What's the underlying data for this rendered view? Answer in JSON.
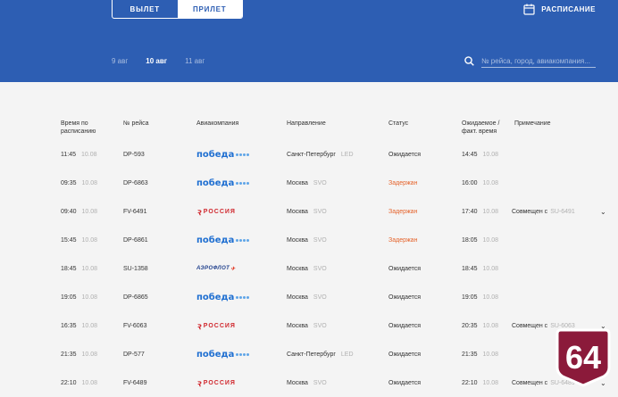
{
  "tabs": {
    "departure": "ВЫЛЕТ",
    "arrival": "ПРИЛЕТ"
  },
  "schedule_label": "РАСПИСАНИЕ",
  "dates": [
    "9 авг",
    "10 авг",
    "11 авг"
  ],
  "search": {
    "placeholder": "№ рейса, город, авиакомпания..."
  },
  "headers": {
    "scheduled": "Время по расписанию",
    "flight": "№ рейса",
    "airline": "Авиакомпания",
    "direction": "Направление",
    "status": "Статус",
    "expected": "Ожидаемое / факт. время",
    "note": "Примечание"
  },
  "logos": {
    "pobeda": "победа",
    "russia": "РОССИЯ",
    "aeroflot": "АЭРОФЛОТ"
  },
  "rows": [
    {
      "time": "11:45",
      "date": "10.08",
      "flight": "DP-593",
      "airline": "pobeda",
      "city": "Санкт-Петербург",
      "code": "LED",
      "status": "Ожидается",
      "exp_time": "14:45",
      "exp_date": "10.08",
      "note_prefix": "",
      "note_code": ""
    },
    {
      "time": "09:35",
      "date": "10.08",
      "flight": "DP-6863",
      "airline": "pobeda",
      "city": "Москва",
      "code": "SVO",
      "status": "Задержан",
      "exp_time": "16:00",
      "exp_date": "10.08",
      "note_prefix": "",
      "note_code": ""
    },
    {
      "time": "09:40",
      "date": "10.08",
      "flight": "FV-6491",
      "airline": "russia",
      "city": "Москва",
      "code": "SVO",
      "status": "Задержан",
      "exp_time": "17:40",
      "exp_date": "10.08",
      "note_prefix": "Совмещен с",
      "note_code": "SU-6491"
    },
    {
      "time": "15:45",
      "date": "10.08",
      "flight": "DP-6861",
      "airline": "pobeda",
      "city": "Москва",
      "code": "SVO",
      "status": "Задержан",
      "exp_time": "18:05",
      "exp_date": "10.08",
      "note_prefix": "",
      "note_code": ""
    },
    {
      "time": "18:45",
      "date": "10.08",
      "flight": "SU-1358",
      "airline": "aeroflot",
      "city": "Москва",
      "code": "SVO",
      "status": "Ожидается",
      "exp_time": "18:45",
      "exp_date": "10.08",
      "note_prefix": "",
      "note_code": ""
    },
    {
      "time": "19:05",
      "date": "10.08",
      "flight": "DP-6865",
      "airline": "pobeda",
      "city": "Москва",
      "code": "SVO",
      "status": "Ожидается",
      "exp_time": "19:05",
      "exp_date": "10.08",
      "note_prefix": "",
      "note_code": ""
    },
    {
      "time": "16:35",
      "date": "10.08",
      "flight": "FV-6063",
      "airline": "russia",
      "city": "Москва",
      "code": "SVO",
      "status": "Ожидается",
      "exp_time": "20:35",
      "exp_date": "10.08",
      "note_prefix": "Совмещен с",
      "note_code": "SU-6063"
    },
    {
      "time": "21:35",
      "date": "10.08",
      "flight": "DP-577",
      "airline": "pobeda",
      "city": "Санкт-Петербург",
      "code": "LED",
      "status": "Ожидается",
      "exp_time": "21:35",
      "exp_date": "10.08",
      "note_prefix": "",
      "note_code": ""
    },
    {
      "time": "22:10",
      "date": "10.08",
      "flight": "FV-6489",
      "airline": "russia",
      "city": "Москва",
      "code": "SVO",
      "status": "Ожидается",
      "exp_time": "22:10",
      "exp_date": "10.08",
      "note_prefix": "Совмещен с",
      "note_code": "SU-6489"
    }
  ],
  "badge": {
    "text": "64"
  },
  "colors": {
    "header": "#2d5eb3",
    "delayed": "#e5622a",
    "badge": "#8b1a3a"
  }
}
